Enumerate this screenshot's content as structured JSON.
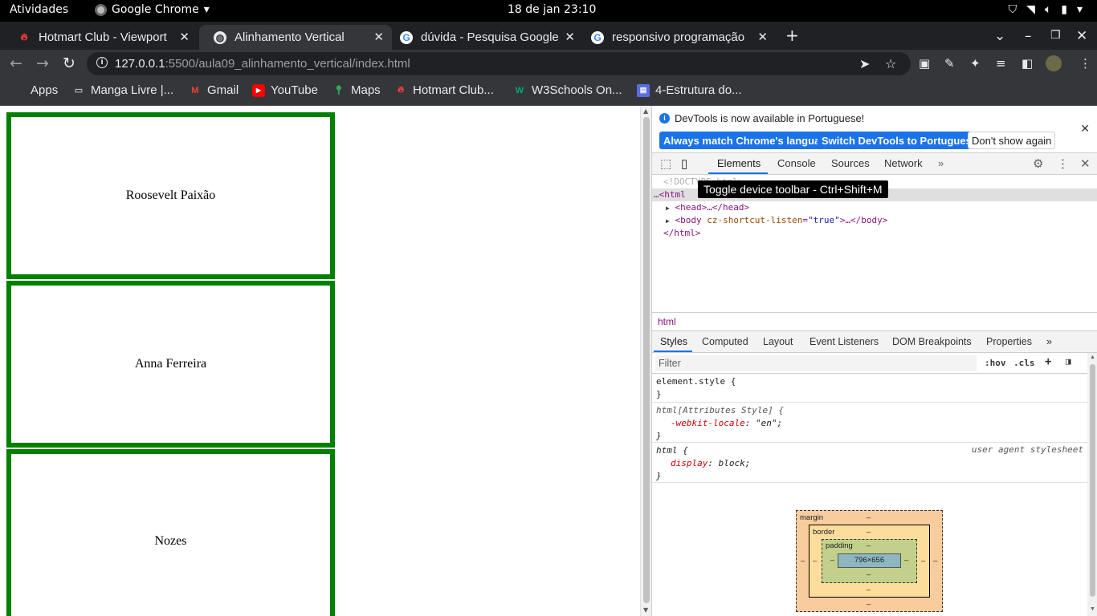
{
  "gnome": {
    "activities": "Atividades",
    "app_name": "Google Chrome",
    "clock": "18 de jan  23:10"
  },
  "tabs": [
    {
      "title": "Hotmart Club - Viewport",
      "favicon": "hotmart-icon",
      "active": false
    },
    {
      "title": "Alinhamento Vertical",
      "favicon": "globe-icon",
      "active": true
    },
    {
      "title": "dúvida - Pesquisa Google",
      "favicon": "google-icon",
      "active": false
    },
    {
      "title": "responsivo programação",
      "favicon": "google-icon",
      "active": false
    }
  ],
  "address": {
    "host": "127.0.0.1",
    "path": ":5500/aula09_alinhamento_vertical/index.html"
  },
  "bookmarks": [
    {
      "label": "Apps"
    },
    {
      "label": "Manga Livre |..."
    },
    {
      "label": "Gmail"
    },
    {
      "label": "YouTube"
    },
    {
      "label": "Maps"
    },
    {
      "label": "Hotmart Club..."
    },
    {
      "label": "W3Schools On..."
    },
    {
      "label": "4-Estrutura do..."
    }
  ],
  "page": {
    "cards": [
      "Roosevelt Paixão",
      "Anna Ferreira",
      "Nozes"
    ],
    "border_color": "#008000"
  },
  "devtools": {
    "banner_text": "DevTools is now available in Portuguese!",
    "btn_always": "Always match Chrome's language",
    "btn_switch": "Switch DevTools to Portuguese",
    "btn_dont": "Don't show again",
    "tabs": [
      "Elements",
      "Console",
      "Sources",
      "Network"
    ],
    "tooltip": "Toggle device toolbar - Ctrl+Shift+M",
    "crumb": "html",
    "subtabs": [
      "Styles",
      "Computed",
      "Layout",
      "Event Listeners",
      "DOM Breakpoints",
      "Properties"
    ],
    "filter_placeholder": "Filter",
    "hov": ":hov",
    "cls": ".cls",
    "dom": {
      "doctype": "<!DOCTYPE html>",
      "html_open": "<html",
      "head": "<head>…</head>",
      "body_tag": "<body",
      "body_attr": "cz-shortcut-listen",
      "body_val": "\"true\"",
      "body_close": ">…</body>",
      "html_close": "</html>"
    },
    "rules": {
      "element_style": "element.style {",
      "close": "}",
      "attr_selector": "html[Attributes Style] {",
      "attr_prop": "-webkit-locale",
      "attr_val": "\"en\";",
      "ua_selector": "html {",
      "ua_source": "user agent stylesheet",
      "ua_prop": "display",
      "ua_val": "block;"
    },
    "boxmodel": {
      "margin": "margin",
      "border": "border",
      "padding": "padding",
      "content": "796×656",
      "dash": "–"
    }
  }
}
